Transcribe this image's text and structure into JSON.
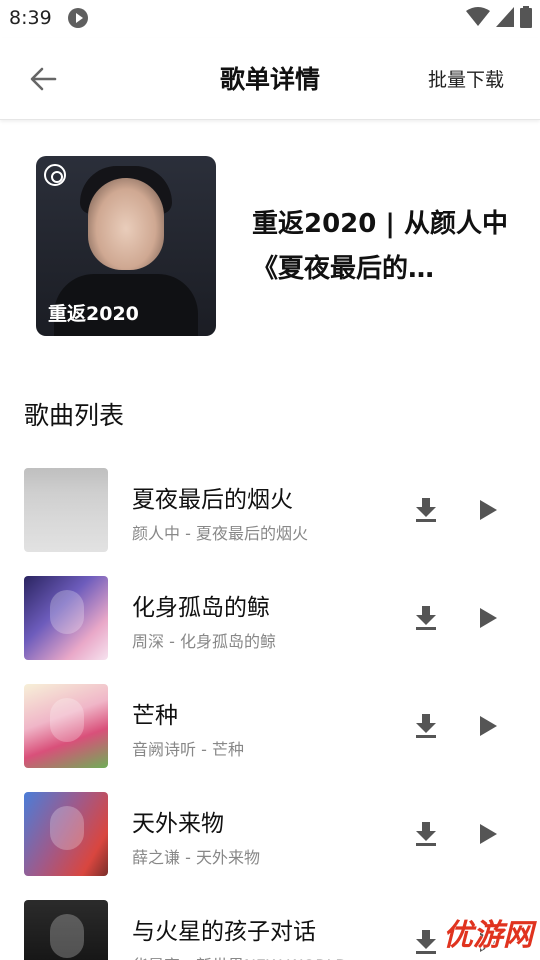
{
  "status_bar": {
    "time": "8:39"
  },
  "header": {
    "title": "歌单详情",
    "batch_download": "批量下载"
  },
  "playlist": {
    "cover_text": "重返2020",
    "title": "重返2020 | 从颜人中《夏夜最后的…"
  },
  "section_title": "歌曲列表",
  "songs": [
    {
      "name": "夏夜最后的烟火",
      "subtitle": "颜人中 - 夏夜最后的烟火"
    },
    {
      "name": "化身孤岛的鲸",
      "subtitle": "周深 - 化身孤岛的鲸"
    },
    {
      "name": "芒种",
      "subtitle": "音阙诗听 - 芒种"
    },
    {
      "name": "天外来物",
      "subtitle": "薛之谦 - 天外来物"
    },
    {
      "name": "与火星的孩子对话",
      "subtitle": "华晨宇 - 新世界NEW WORLD"
    }
  ],
  "watermark": "优游网",
  "colors": {
    "icon": "#555555",
    "secondary_text": "#888888",
    "watermark": "#e0331f"
  }
}
